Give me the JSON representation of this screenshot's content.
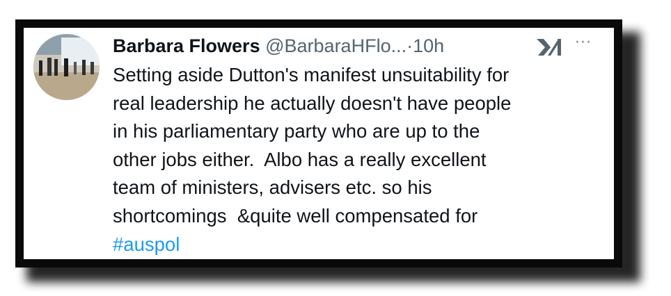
{
  "tweet": {
    "author_name": "Barbara Flowers",
    "author_handle": "@BarbaraHFlo...",
    "separator": "·",
    "time_ago": "10h",
    "more_glyph": "···",
    "text_lines": [
      "Setting aside Dutton's manifest unsuitability for",
      "real leadership he actually doesn't have people",
      "in his parliamentary party who are up to the",
      "other jobs either.  Albo has a really excellent",
      "team of ministers, advisers etc. so his",
      "shortcomings  &quite well compensated for"
    ],
    "hashtag": "#auspol"
  },
  "colors": {
    "text": "#0f1419",
    "secondary": "#536471",
    "link": "#1d9bf0",
    "frame": "#0a0a0a"
  },
  "icons": {
    "avatar": "profile-photo",
    "brand": "xai-grok-icon",
    "more": "more-icon"
  }
}
